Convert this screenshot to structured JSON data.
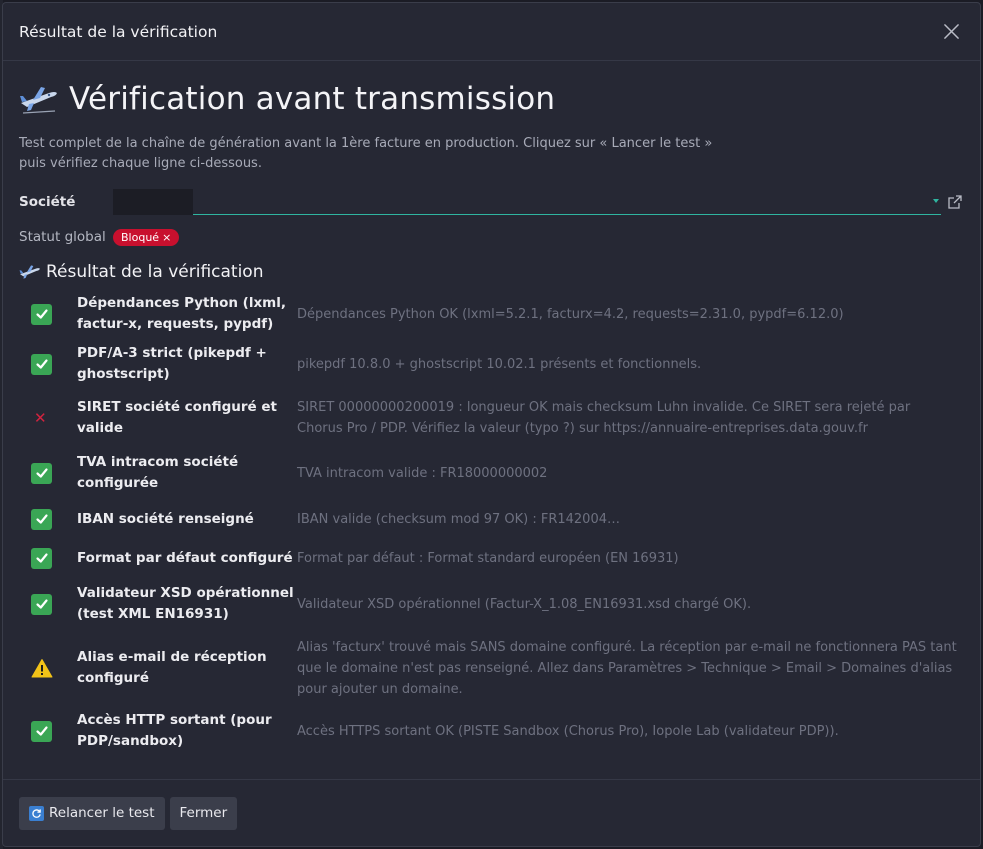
{
  "dialog": {
    "title": "Résultat de la vérification"
  },
  "page": {
    "heading": "Vérification avant transmission",
    "intro": "Test complet de la chaîne de génération avant la 1ère facture en production. Cliquez sur « Lancer le test » puis vérifiez chaque ligne ci-dessous."
  },
  "company": {
    "label": "Société",
    "value": ""
  },
  "status": {
    "label": "Statut global",
    "badge": "Bloqué",
    "badge_icon": "×",
    "badge_color": "#c8102e"
  },
  "results": {
    "title": "Résultat de la vérification",
    "checks": [
      {
        "status": "ok",
        "name": "Dépendances Python (lxml, factur-x, requests, pypdf)",
        "detail": "Dépendances Python OK (lxml=5.2.1, facturx=4.2, requests=2.31.0, pypdf=6.12.0)"
      },
      {
        "status": "ok",
        "name": "PDF/A-3 strict (pikepdf + ghostscript)",
        "detail": "pikepdf 10.8.0 + ghostscript 10.02.1 présents et fonctionnels."
      },
      {
        "status": "fail",
        "name": "SIRET société configuré et valide",
        "detail": "SIRET 00000000200019 : longueur OK mais checksum Luhn invalide. Ce SIRET sera rejeté par Chorus Pro / PDP. Vérifiez la valeur (typo ?) sur https://annuaire-entreprises.data.gouv.fr"
      },
      {
        "status": "ok",
        "name": "TVA intracom société configurée",
        "detail": "TVA intracom valide : FR18000000002"
      },
      {
        "status": "ok",
        "name": "IBAN société renseigné",
        "detail": "IBAN valide (checksum mod 97 OK) : FR142004…"
      },
      {
        "status": "ok",
        "name": "Format par défaut configuré",
        "detail": "Format par défaut : Format standard européen (EN 16931)"
      },
      {
        "status": "ok",
        "name": "Validateur XSD opérationnel (test XML EN16931)",
        "detail": "Validateur XSD opérationnel (Factur-X_1.08_EN16931.xsd chargé OK)."
      },
      {
        "status": "warn",
        "name": "Alias e-mail de réception configuré",
        "detail": "Alias 'facturx' trouvé mais SANS domaine configuré. La réception par e-mail ne fonctionnera PAS tant que le domaine n'est pas renseigné. Allez dans Paramètres > Technique > Email > Domaines d'alias pour ajouter un domaine."
      },
      {
        "status": "ok",
        "name": "Accès HTTP sortant (pour PDP/sandbox)",
        "detail": "Accès HTTPS sortant OK (PISTE Sandbox (Chorus Pro), Iopole Lab (validateur PDP))."
      }
    ]
  },
  "footer": {
    "rerun_label": "Relancer le test",
    "rerun_icon": "refresh-icon",
    "close_label": "Fermer"
  },
  "colors": {
    "ok": "#3aa655",
    "fail": "#d2233f",
    "warn": "#f2c318",
    "accent": "#2fb5a0"
  }
}
